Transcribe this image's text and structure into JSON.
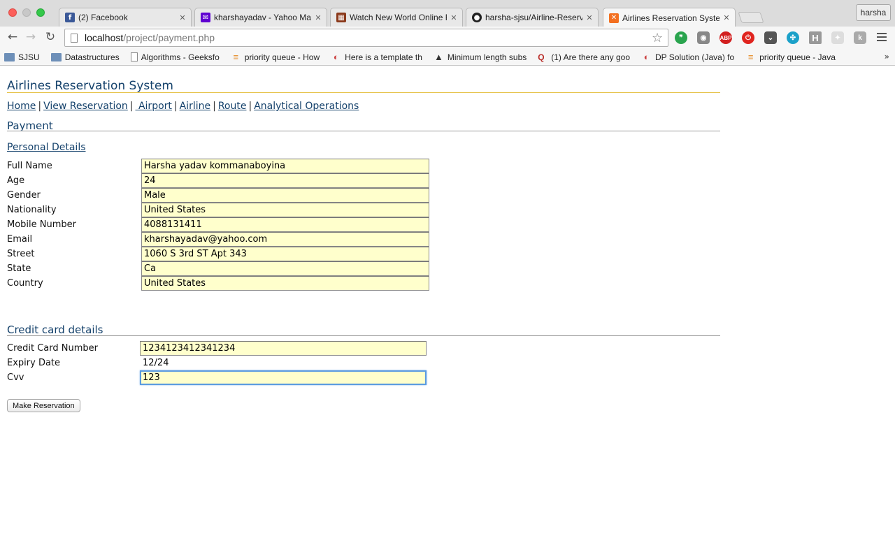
{
  "browser": {
    "tabs": [
      {
        "title": "(2) Facebook",
        "icon": "facebook-icon",
        "color": "#3b5998"
      },
      {
        "title": "kharshayadav - Yahoo Mail",
        "icon": "yahoo-mail-icon",
        "color": "#5f01d1"
      },
      {
        "title": "Watch New World Online Fr",
        "icon": "film-icon",
        "color": "#8b3a1c"
      },
      {
        "title": "harsha-sjsu/Airline-Reserva",
        "icon": "github-icon",
        "color": "#222222"
      },
      {
        "title": "Airlines Reservation System",
        "icon": "xampp-icon",
        "color": "#f37021"
      }
    ],
    "profile": "harsha",
    "url_host": "localhost",
    "url_path": "/project/payment.php",
    "bookmarks": [
      {
        "label": "SJSU",
        "icon": "folder-icon"
      },
      {
        "label": "Datastructures",
        "icon": "folder-icon"
      },
      {
        "label": "Algorithms - Geeksfo",
        "icon": "document-icon"
      },
      {
        "label": "priority queue - How",
        "icon": "stackoverflow-icon"
      },
      {
        "label": "Here is a template th",
        "icon": "lock-icon"
      },
      {
        "label": "Minimum length subs",
        "icon": "triangle-icon"
      },
      {
        "label": "(1) Are there any goo",
        "icon": "quora-icon"
      },
      {
        "label": "DP Solution (Java) fo",
        "icon": "lock-icon"
      },
      {
        "label": "priority queue - Java",
        "icon": "stackoverflow-icon"
      }
    ],
    "bookmarks_more": "»"
  },
  "site": {
    "title": "Airlines Reservation System",
    "nav": {
      "home": "Home",
      "view_reservation": "View Reservation",
      "airport": " Airport",
      "airline": "Airline",
      "route": "Route",
      "analytical": "Analytical Operations"
    },
    "heading": "Payment"
  },
  "personal": {
    "heading": "Personal Details",
    "fields": [
      {
        "label": "Full Name",
        "value": "Harsha yadav kommanaboyina"
      },
      {
        "label": "Age",
        "value": "24"
      },
      {
        "label": "Gender",
        "value": "Male"
      },
      {
        "label": "Nationality",
        "value": "United States"
      },
      {
        "label": "Mobile Number",
        "value": "4088131411"
      },
      {
        "label": "Email",
        "value": "kharshayadav@yahoo.com"
      },
      {
        "label": "Street",
        "value": "1060 S 3rd ST Apt 343"
      },
      {
        "label": "State",
        "value": "Ca"
      },
      {
        "label": "Country",
        "value": "United States"
      }
    ]
  },
  "credit": {
    "heading": "Credit card details",
    "fields": [
      {
        "label": "Credit Card Number",
        "value": "1234123412341234"
      },
      {
        "label": "Expiry Date",
        "value": "12/24"
      },
      {
        "label": "Cvv",
        "value": "123"
      }
    ]
  },
  "submit_label": "Make Reservation"
}
